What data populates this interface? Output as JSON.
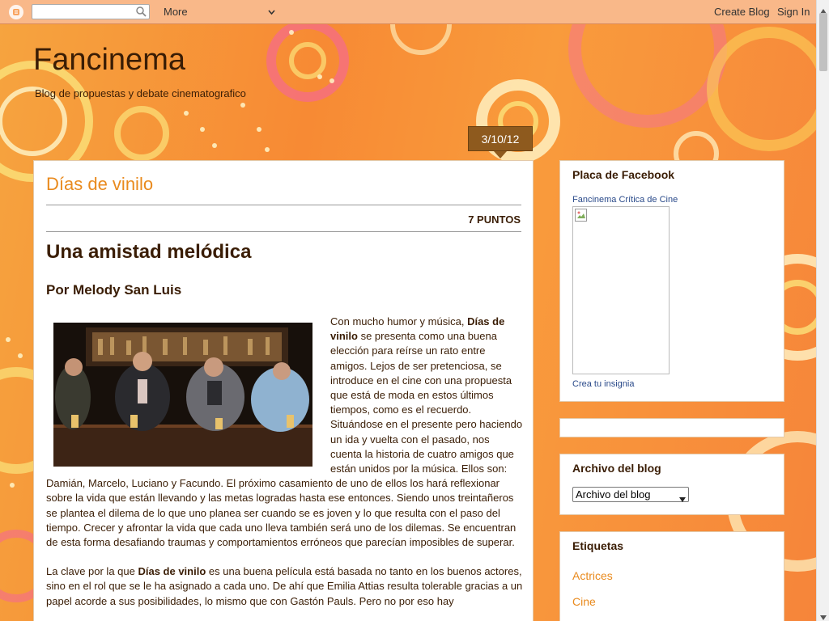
{
  "navbar": {
    "more_label": "More",
    "create_blog": "Create Blog",
    "sign_in": "Sign In"
  },
  "header": {
    "title": "Fancinema",
    "description": "Blog de propuestas y debate cinematografico"
  },
  "post": {
    "date": "3/10/12",
    "title": "Días de vinilo",
    "points": "7 PUNTOS",
    "heading": "Una amistad melódica",
    "author": "Por Melody San Luis",
    "p1_a": "Con mucho humor y música, ",
    "p1_bold": "Días de vinilo",
    "p1_b": " se presenta como una buena elección para reírse un rato entre amigos. Lejos de ser pretenciosa, se introduce en el cine con una propuesta que está de moda en estos últimos tiempos, como es el recuerdo. Situándose en el presente pero haciendo un ida y vuelta con el pasado, nos cuenta la historia de cuatro amigos que están unidos por la música. Ellos son: Damián, Marcelo, Luciano y Facundo. El próximo casamiento de uno de ellos los hará reflexionar sobre la vida que están llevando y las metas logradas hasta ese entonces. Siendo unos treintañeros se plantea el dilema de lo que uno planea ser cuando se es joven y lo que resulta con el paso del tiempo. Crecer y afrontar la vida que cada uno lleva también será uno de los dilemas. Se encuentran de esta forma desafiando traumas y comportamientos erróneos que parecían imposibles de superar.",
    "p2_a": "La clave por la que ",
    "p2_bold": "Días de vinilo",
    "p2_b": " es una buena película está basada no tanto en los buenos actores, sino en el rol que se le ha asignado a cada uno. De ahí que Emilia Attias resulta tolerable gracias a un papel acorde a sus posibilidades, lo mismo que con Gastón Pauls. Pero no por eso hay"
  },
  "sidebar": {
    "facebook": {
      "title": "Placa de Facebook",
      "link": "Fancinema Crítica de Cine",
      "create": "Crea tu insignia"
    },
    "archive": {
      "title": "Archivo del blog",
      "selected": "Archivo del blog"
    },
    "labels": {
      "title": "Etiquetas",
      "items": [
        "Actrices",
        "Cine"
      ]
    }
  },
  "colors": {
    "accent": "#e98a1d",
    "text": "#3a1d05",
    "date_badge": "#8e5a1e"
  }
}
